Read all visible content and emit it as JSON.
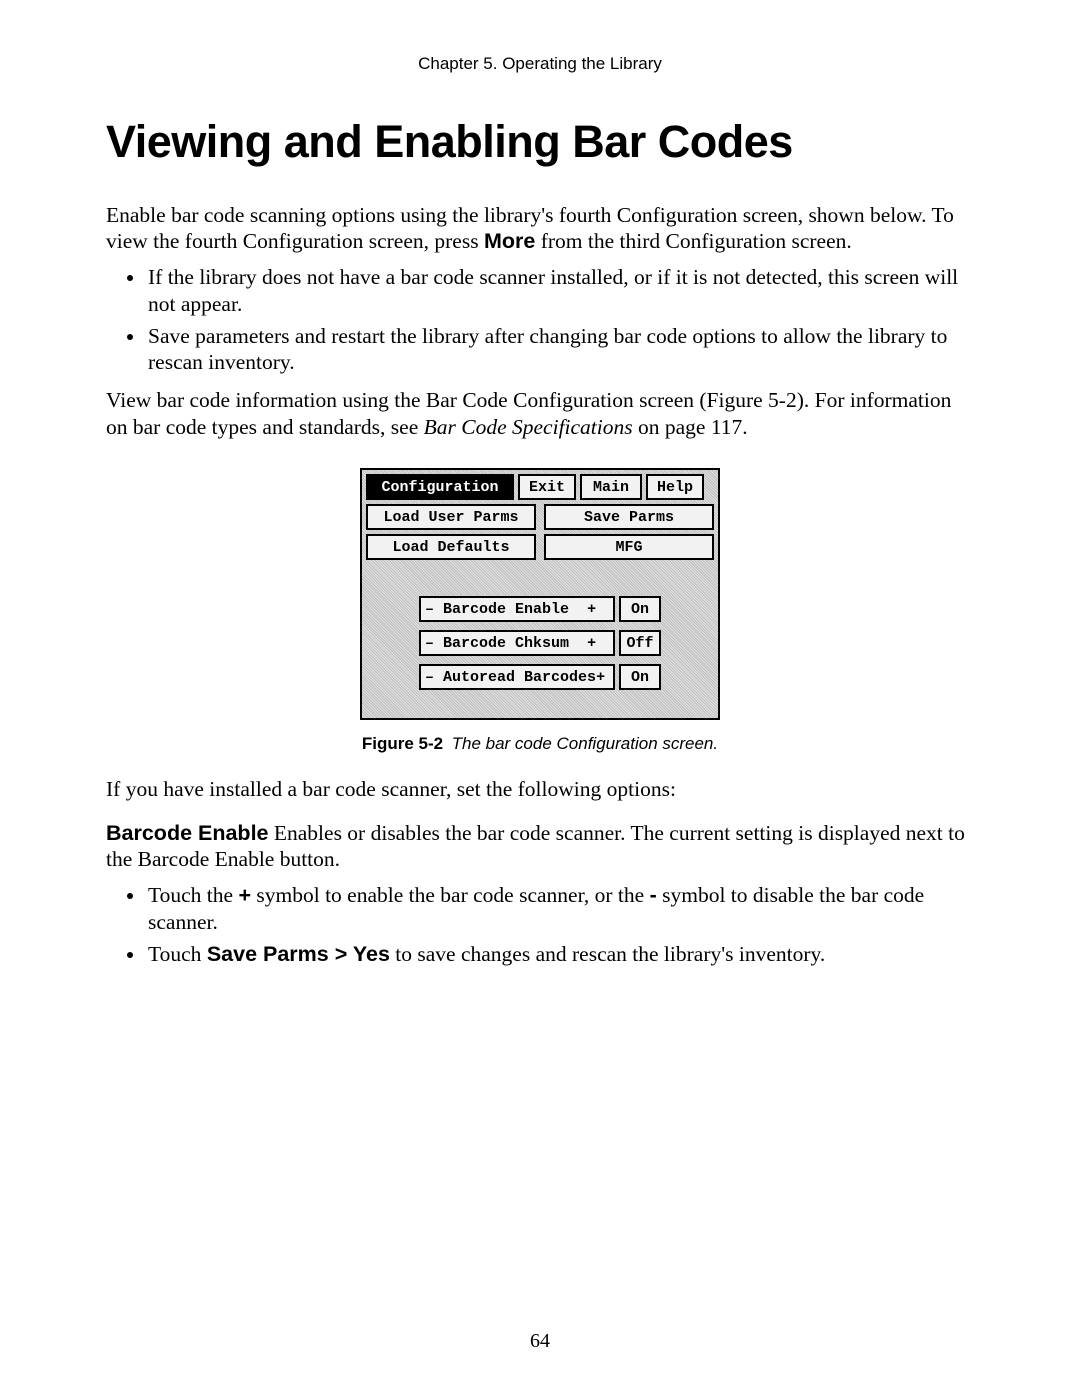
{
  "running_head": "Chapter 5.  Operating the Library",
  "title": "Viewing and Enabling Bar Codes",
  "intro_part1": "Enable bar code scanning options using the library's fourth Configuration screen, shown below. To view the fourth Configuration screen, press ",
  "intro_more": "More",
  "intro_part2": " from the third Configuration screen.",
  "bullets1": [
    "If the library does not have a bar code scanner installed, or if it is not detected, this screen will not appear.",
    "Save parameters and restart the library after changing bar code options to allow the library to rescan inventory."
  ],
  "para2_part1": "View bar code information using the Bar Code Configuration screen (Figure 5-2). For information on bar code types and standards, see ",
  "para2_ital": "Bar Code Specifications",
  "para2_part2": " on page 117.",
  "screen": {
    "top": [
      "Configuration",
      "Exit",
      "Main",
      "Help"
    ],
    "row2": [
      "Load User Parms",
      "Save Parms"
    ],
    "row3": [
      "Load Defaults",
      "MFG"
    ],
    "opts": [
      {
        "minus": "–",
        "label": "Barcode Enable",
        "plus": "+",
        "val": "On"
      },
      {
        "minus": "–",
        "label": "Barcode Chksum",
        "plus": "+",
        "val": "Off"
      },
      {
        "minus": "–",
        "label": "Autoread Barcodes",
        "plus": "+",
        "val": "On"
      }
    ]
  },
  "fig_num": "Figure 5-2",
  "fig_txt": "The bar code Configuration screen.",
  "para3": "If you have installed a bar code scanner, set the following options:",
  "be_label": "Barcode Enable",
  "be_text": "  Enables or disables the bar code scanner. The current setting is displayed next to the Barcode Enable button.",
  "bullets2a_1": "Touch the ",
  "bullets2a_plus": "+",
  "bullets2a_2": " symbol to enable the bar code scanner, or the ",
  "bullets2a_minus": "-",
  "bullets2a_3": " symbol to disable the bar code scanner.",
  "bullets2b_1": "Touch ",
  "bullets2b_bold": "Save Parms > Yes",
  "bullets2b_2": " to save changes and rescan the library's inventory.",
  "page_number": "64"
}
